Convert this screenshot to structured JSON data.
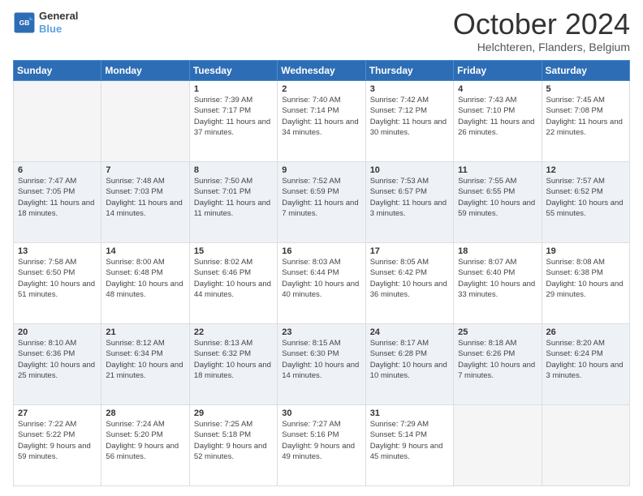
{
  "logo": {
    "line1": "General",
    "line2": "Blue"
  },
  "title": "October 2024",
  "subtitle": "Helchteren, Flanders, Belgium",
  "days_of_week": [
    "Sunday",
    "Monday",
    "Tuesday",
    "Wednesday",
    "Thursday",
    "Friday",
    "Saturday"
  ],
  "weeks": [
    [
      {
        "day": "",
        "sunrise": "",
        "sunset": "",
        "daylight": ""
      },
      {
        "day": "",
        "sunrise": "",
        "sunset": "",
        "daylight": ""
      },
      {
        "day": "1",
        "sunrise": "Sunrise: 7:39 AM",
        "sunset": "Sunset: 7:17 PM",
        "daylight": "Daylight: 11 hours and 37 minutes."
      },
      {
        "day": "2",
        "sunrise": "Sunrise: 7:40 AM",
        "sunset": "Sunset: 7:14 PM",
        "daylight": "Daylight: 11 hours and 34 minutes."
      },
      {
        "day": "3",
        "sunrise": "Sunrise: 7:42 AM",
        "sunset": "Sunset: 7:12 PM",
        "daylight": "Daylight: 11 hours and 30 minutes."
      },
      {
        "day": "4",
        "sunrise": "Sunrise: 7:43 AM",
        "sunset": "Sunset: 7:10 PM",
        "daylight": "Daylight: 11 hours and 26 minutes."
      },
      {
        "day": "5",
        "sunrise": "Sunrise: 7:45 AM",
        "sunset": "Sunset: 7:08 PM",
        "daylight": "Daylight: 11 hours and 22 minutes."
      }
    ],
    [
      {
        "day": "6",
        "sunrise": "Sunrise: 7:47 AM",
        "sunset": "Sunset: 7:05 PM",
        "daylight": "Daylight: 11 hours and 18 minutes."
      },
      {
        "day": "7",
        "sunrise": "Sunrise: 7:48 AM",
        "sunset": "Sunset: 7:03 PM",
        "daylight": "Daylight: 11 hours and 14 minutes."
      },
      {
        "day": "8",
        "sunrise": "Sunrise: 7:50 AM",
        "sunset": "Sunset: 7:01 PM",
        "daylight": "Daylight: 11 hours and 11 minutes."
      },
      {
        "day": "9",
        "sunrise": "Sunrise: 7:52 AM",
        "sunset": "Sunset: 6:59 PM",
        "daylight": "Daylight: 11 hours and 7 minutes."
      },
      {
        "day": "10",
        "sunrise": "Sunrise: 7:53 AM",
        "sunset": "Sunset: 6:57 PM",
        "daylight": "Daylight: 11 hours and 3 minutes."
      },
      {
        "day": "11",
        "sunrise": "Sunrise: 7:55 AM",
        "sunset": "Sunset: 6:55 PM",
        "daylight": "Daylight: 10 hours and 59 minutes."
      },
      {
        "day": "12",
        "sunrise": "Sunrise: 7:57 AM",
        "sunset": "Sunset: 6:52 PM",
        "daylight": "Daylight: 10 hours and 55 minutes."
      }
    ],
    [
      {
        "day": "13",
        "sunrise": "Sunrise: 7:58 AM",
        "sunset": "Sunset: 6:50 PM",
        "daylight": "Daylight: 10 hours and 51 minutes."
      },
      {
        "day": "14",
        "sunrise": "Sunrise: 8:00 AM",
        "sunset": "Sunset: 6:48 PM",
        "daylight": "Daylight: 10 hours and 48 minutes."
      },
      {
        "day": "15",
        "sunrise": "Sunrise: 8:02 AM",
        "sunset": "Sunset: 6:46 PM",
        "daylight": "Daylight: 10 hours and 44 minutes."
      },
      {
        "day": "16",
        "sunrise": "Sunrise: 8:03 AM",
        "sunset": "Sunset: 6:44 PM",
        "daylight": "Daylight: 10 hours and 40 minutes."
      },
      {
        "day": "17",
        "sunrise": "Sunrise: 8:05 AM",
        "sunset": "Sunset: 6:42 PM",
        "daylight": "Daylight: 10 hours and 36 minutes."
      },
      {
        "day": "18",
        "sunrise": "Sunrise: 8:07 AM",
        "sunset": "Sunset: 6:40 PM",
        "daylight": "Daylight: 10 hours and 33 minutes."
      },
      {
        "day": "19",
        "sunrise": "Sunrise: 8:08 AM",
        "sunset": "Sunset: 6:38 PM",
        "daylight": "Daylight: 10 hours and 29 minutes."
      }
    ],
    [
      {
        "day": "20",
        "sunrise": "Sunrise: 8:10 AM",
        "sunset": "Sunset: 6:36 PM",
        "daylight": "Daylight: 10 hours and 25 minutes."
      },
      {
        "day": "21",
        "sunrise": "Sunrise: 8:12 AM",
        "sunset": "Sunset: 6:34 PM",
        "daylight": "Daylight: 10 hours and 21 minutes."
      },
      {
        "day": "22",
        "sunrise": "Sunrise: 8:13 AM",
        "sunset": "Sunset: 6:32 PM",
        "daylight": "Daylight: 10 hours and 18 minutes."
      },
      {
        "day": "23",
        "sunrise": "Sunrise: 8:15 AM",
        "sunset": "Sunset: 6:30 PM",
        "daylight": "Daylight: 10 hours and 14 minutes."
      },
      {
        "day": "24",
        "sunrise": "Sunrise: 8:17 AM",
        "sunset": "Sunset: 6:28 PM",
        "daylight": "Daylight: 10 hours and 10 minutes."
      },
      {
        "day": "25",
        "sunrise": "Sunrise: 8:18 AM",
        "sunset": "Sunset: 6:26 PM",
        "daylight": "Daylight: 10 hours and 7 minutes."
      },
      {
        "day": "26",
        "sunrise": "Sunrise: 8:20 AM",
        "sunset": "Sunset: 6:24 PM",
        "daylight": "Daylight: 10 hours and 3 minutes."
      }
    ],
    [
      {
        "day": "27",
        "sunrise": "Sunrise: 7:22 AM",
        "sunset": "Sunset: 5:22 PM",
        "daylight": "Daylight: 9 hours and 59 minutes."
      },
      {
        "day": "28",
        "sunrise": "Sunrise: 7:24 AM",
        "sunset": "Sunset: 5:20 PM",
        "daylight": "Daylight: 9 hours and 56 minutes."
      },
      {
        "day": "29",
        "sunrise": "Sunrise: 7:25 AM",
        "sunset": "Sunset: 5:18 PM",
        "daylight": "Daylight: 9 hours and 52 minutes."
      },
      {
        "day": "30",
        "sunrise": "Sunrise: 7:27 AM",
        "sunset": "Sunset: 5:16 PM",
        "daylight": "Daylight: 9 hours and 49 minutes."
      },
      {
        "day": "31",
        "sunrise": "Sunrise: 7:29 AM",
        "sunset": "Sunset: 5:14 PM",
        "daylight": "Daylight: 9 hours and 45 minutes."
      },
      {
        "day": "",
        "sunrise": "",
        "sunset": "",
        "daylight": ""
      },
      {
        "day": "",
        "sunrise": "",
        "sunset": "",
        "daylight": ""
      }
    ]
  ]
}
